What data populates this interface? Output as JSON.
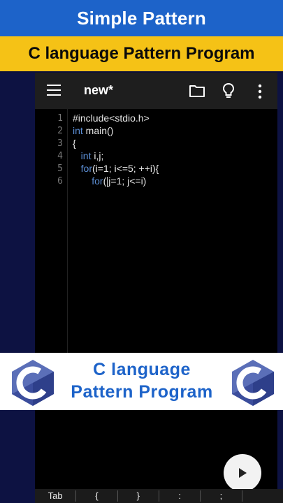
{
  "banner": {
    "top_title": "Simple Pattern",
    "subtitle": "C language Pattern Program"
  },
  "toolbar": {
    "title": "new*",
    "icons": [
      "menu-icon",
      "folder-icon",
      "lightbulb-icon",
      "more-vert-icon"
    ]
  },
  "editor": {
    "line_numbers": [
      "1",
      "2",
      "3",
      "4",
      "5",
      "6"
    ],
    "lines": [
      {
        "tokens": [
          {
            "t": "#include<stdio.h>",
            "kw": false
          }
        ]
      },
      {
        "tokens": [
          {
            "t": "int",
            "kw": true
          },
          {
            "t": " main()",
            "kw": false
          }
        ]
      },
      {
        "tokens": [
          {
            "t": "{",
            "kw": false
          }
        ]
      },
      {
        "tokens": [
          {
            "t": "   ",
            "kw": false
          },
          {
            "t": "int",
            "kw": true
          },
          {
            "t": " i,j;",
            "kw": false
          }
        ]
      },
      {
        "tokens": [
          {
            "t": "   ",
            "kw": false
          },
          {
            "t": "for",
            "kw": true
          },
          {
            "t": "(i=1; i<=5; ++i){",
            "kw": false
          }
        ]
      },
      {
        "tokens": [
          {
            "t": "       ",
            "kw": false
          },
          {
            "t": "for",
            "kw": true
          },
          {
            "t": "(",
            "kw": false
          },
          {
            "cursor": true
          },
          {
            "t": "j=1; j<=i)",
            "kw": false
          }
        ]
      }
    ]
  },
  "bottom_banner": {
    "line1": "C language",
    "line2": "Pattern Program"
  },
  "logo": {
    "letter": "C"
  },
  "keybar": {
    "keys": [
      "Tab",
      "{",
      "}",
      ":",
      ";",
      ""
    ]
  },
  "colors": {
    "banner_blue": "#1d63c9",
    "banner_yellow": "#f5c216",
    "keyword": "#5c8fd6"
  }
}
